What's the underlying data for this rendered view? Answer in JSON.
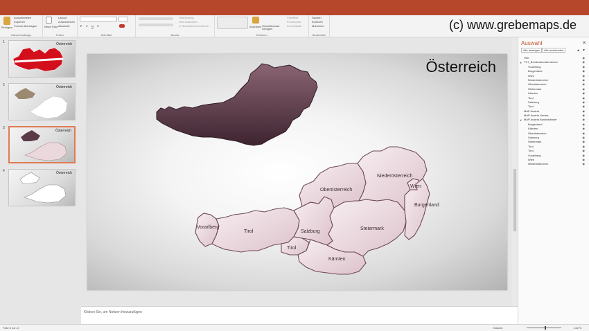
{
  "app": {
    "accent": "#b7472a",
    "watermark": "(c) www.grebemaps.de"
  },
  "ribbon": {
    "clipboard": {
      "paste": "Einfügen",
      "cut": "Ausschneiden",
      "copy": "Kopieren",
      "format_painter": "Format übertragen",
      "group": "Zwischenablage"
    },
    "slides": {
      "new_slide": "Neue Folie",
      "layout": "Layout",
      "reset": "Zurücksetzen",
      "section": "Abschnitt",
      "group": "Folien"
    },
    "font": {
      "group": "Schriftart",
      "bold": "F",
      "italic": "K",
      "underline": "U",
      "strike": "S"
    },
    "paragraph": {
      "group": "Absatz",
      "text_direction": "Textrichtung",
      "align_text": "Text ausrichten",
      "smartart": "In SmartArt konvertieren"
    },
    "drawing": {
      "arrange": "Anordnen",
      "quick_styles": "Schnellformat-vorlagen",
      "fill": "Fülleffekt",
      "outline": "Formkontur",
      "effects": "Formeffekte",
      "group": "Zeichnen"
    },
    "editing": {
      "find": "Suchen",
      "replace": "Ersetzen",
      "select": "Markieren",
      "group": "Bearbeiten"
    }
  },
  "thumbnails": [
    {
      "number": "1",
      "title": "Österreich"
    },
    {
      "number": "2",
      "title": "Österreich"
    },
    {
      "number": "3",
      "title": "Österreich"
    },
    {
      "number": "4",
      "title": "Österreich"
    }
  ],
  "slide": {
    "title": "Österreich",
    "map_color": "#e8d5da",
    "silhouette_color": "#5a3a48",
    "labels": {
      "vorarlberg": "Vorarlberg",
      "tirol": "Tirol",
      "tirol_east": "Tirol",
      "salzburg": "Salzburg",
      "kaernten": "Kärnten",
      "steiermark": "Steiermark",
      "oberoesterreich": "Oberösterreich",
      "niederoesterreich": "Niederösterreich",
      "wien": "Wien",
      "burgenland": "Burgenland"
    }
  },
  "notes": {
    "placeholder": "Klicken Sie, um Notizen hinzuzufügen"
  },
  "selection_pane": {
    "title": "Auswahl",
    "show_all": "Alle anzeigen",
    "hide_all": "Alle ausblenden",
    "items": [
      {
        "label": "Titel",
        "level": 0,
        "group": false
      },
      {
        "label": "TXT_Bundeslaendernamen",
        "level": 0,
        "group": true
      },
      {
        "label": "Vorarlberg",
        "level": 1,
        "group": false
      },
      {
        "label": "Burgenland",
        "level": 1,
        "group": false
      },
      {
        "label": "Wien",
        "level": 1,
        "group": false
      },
      {
        "label": "Niederösterreich",
        "level": 1,
        "group": false
      },
      {
        "label": "Oberösterreich",
        "level": 1,
        "group": false
      },
      {
        "label": "Steiermark",
        "level": 1,
        "group": false
      },
      {
        "label": "Kärnten",
        "level": 1,
        "group": false
      },
      {
        "label": "Tirol",
        "level": 1,
        "group": false
      },
      {
        "label": "Salzburg",
        "level": 1,
        "group": false
      },
      {
        "label": "Tirol",
        "level": 1,
        "group": false
      },
      {
        "label": "MAP Austria",
        "level": 0,
        "group": false
      },
      {
        "label": "MAP Austria Umriss",
        "level": 0,
        "group": false
      },
      {
        "label": "MAP Austria Bundesländer",
        "level": 0,
        "group": true
      },
      {
        "label": "Burgenland",
        "level": 1,
        "group": false
      },
      {
        "label": "Kärnten",
        "level": 1,
        "group": false
      },
      {
        "label": "Oberösterreich",
        "level": 1,
        "group": false
      },
      {
        "label": "Salzburg",
        "level": 1,
        "group": false
      },
      {
        "label": "Steiermark",
        "level": 1,
        "group": false
      },
      {
        "label": "Tirol",
        "level": 1,
        "group": false
      },
      {
        "label": "Tirol",
        "level": 1,
        "group": false
      },
      {
        "label": "Vorarlberg",
        "level": 1,
        "group": false
      },
      {
        "label": "Wien",
        "level": 1,
        "group": false
      },
      {
        "label": "Niederösterreich",
        "level": 1,
        "group": false
      }
    ]
  },
  "status": {
    "slide_count": "Folie 3 von 4",
    "notes": "Notizen",
    "zoom": "142 %"
  }
}
